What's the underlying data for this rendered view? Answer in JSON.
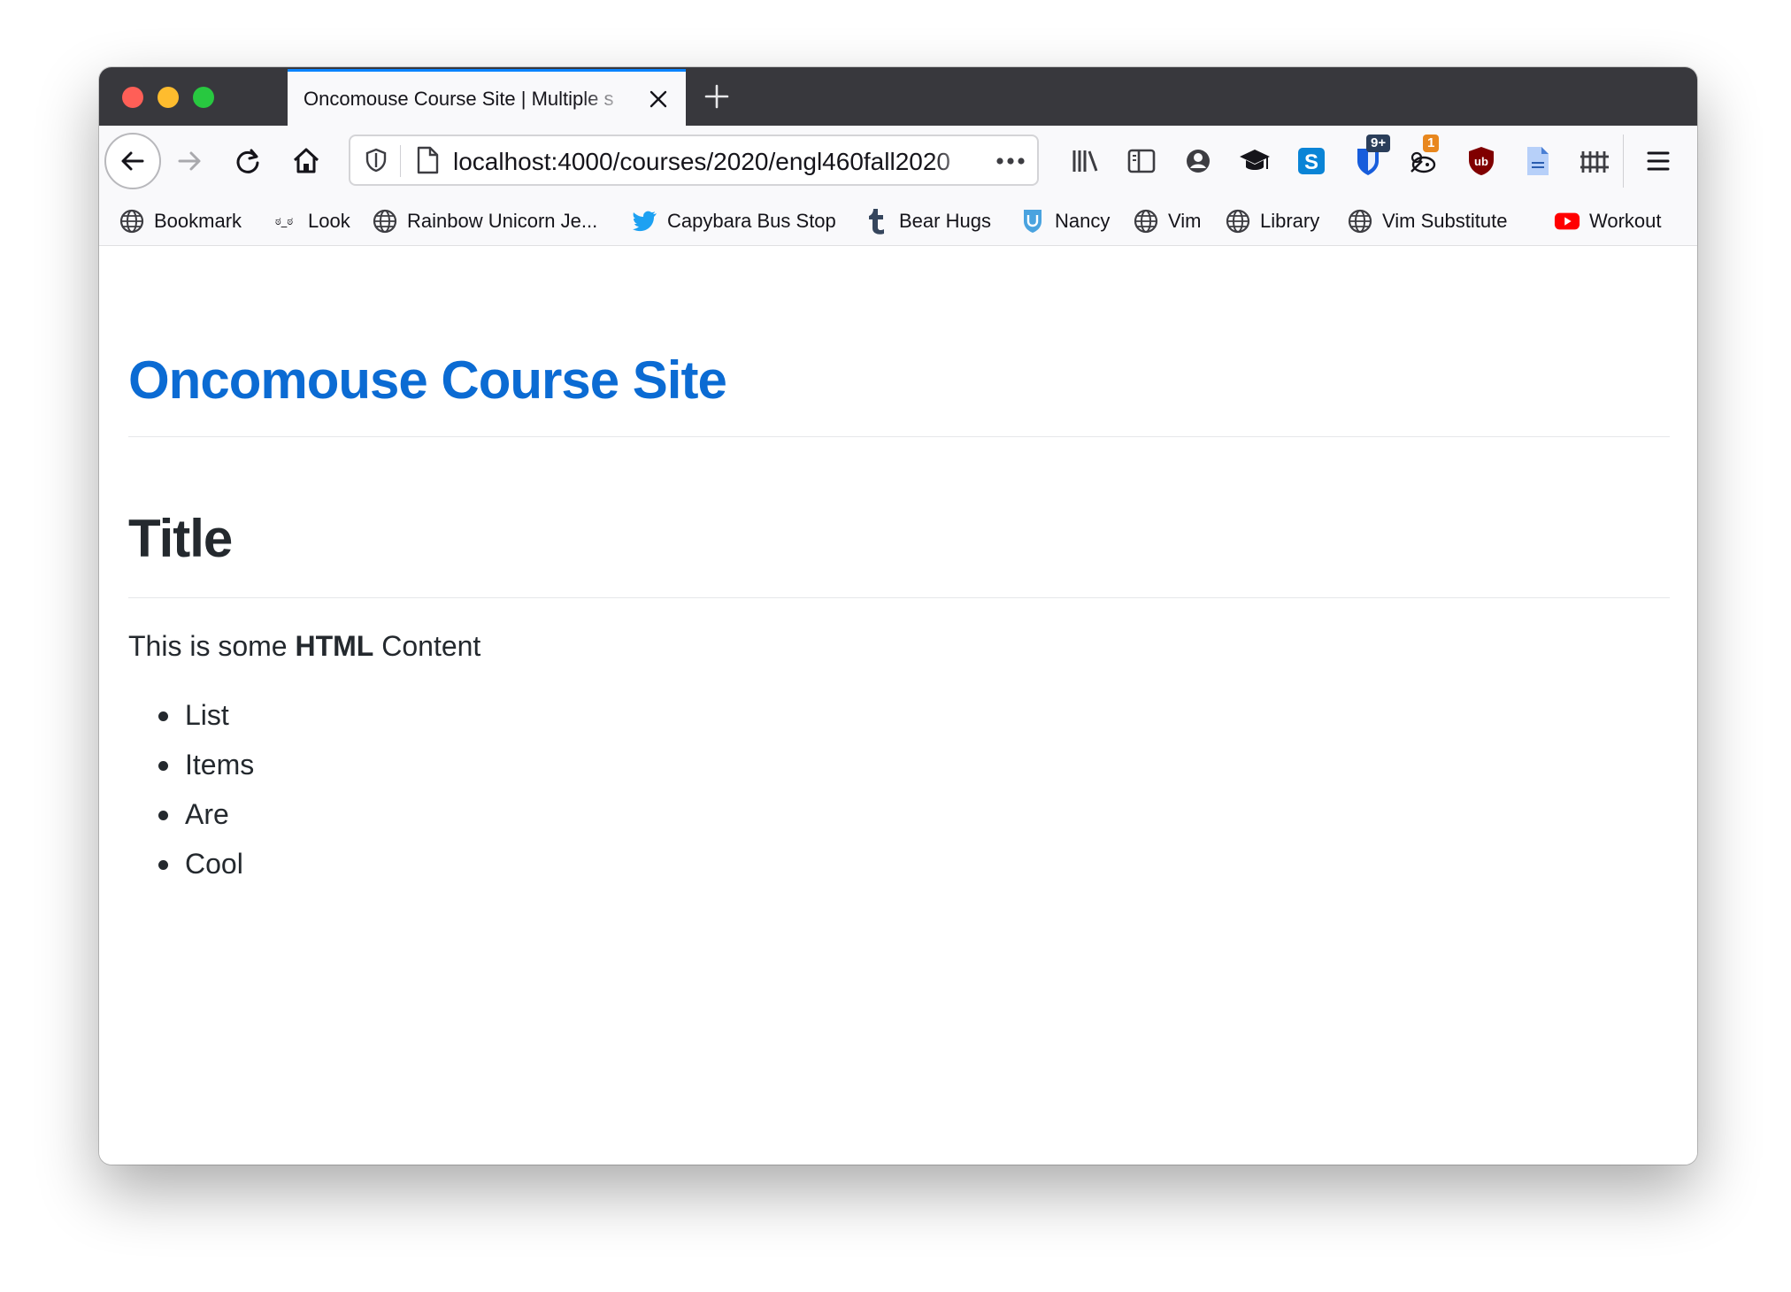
{
  "tab": {
    "title": "Oncomouse Course Site | Multiple s"
  },
  "urlbar": {
    "url": "localhost:4000/courses/2020/engl460fall2020"
  },
  "toolbar": {
    "badges": {
      "bitwarden": "9+",
      "notifications": "1"
    }
  },
  "bookmarks": [
    {
      "label": "Bookmark",
      "icon": "globe-icon"
    },
    {
      "label": "Look",
      "icon": "look-face-icon"
    },
    {
      "label": "Rainbow Unicorn Je...",
      "icon": "globe-icon"
    },
    {
      "label": "Capybara Bus Stop",
      "icon": "twitter-bird-icon"
    },
    {
      "label": "Bear Hugs",
      "icon": "tumblr-icon"
    },
    {
      "label": "Nancy",
      "icon": "shield-icon"
    },
    {
      "label": "Vim",
      "icon": "globe-icon"
    },
    {
      "label": "Library",
      "icon": "globe-icon"
    },
    {
      "label": "Vim Substitute",
      "icon": "globe-icon"
    },
    {
      "label": "Workout",
      "icon": "youtube-icon"
    }
  ],
  "page": {
    "site_title": "Oncomouse Course Site",
    "heading": "Title",
    "paragraph": {
      "before": "This is some ",
      "bold": "HTML",
      "after": " Content"
    },
    "list_items": [
      "List",
      "Items",
      "Are",
      "Cool"
    ]
  },
  "colors": {
    "link_blue": "#0b6bd3",
    "tab_accent": "#0a84ff",
    "tabstrip_bg": "#38383d"
  }
}
